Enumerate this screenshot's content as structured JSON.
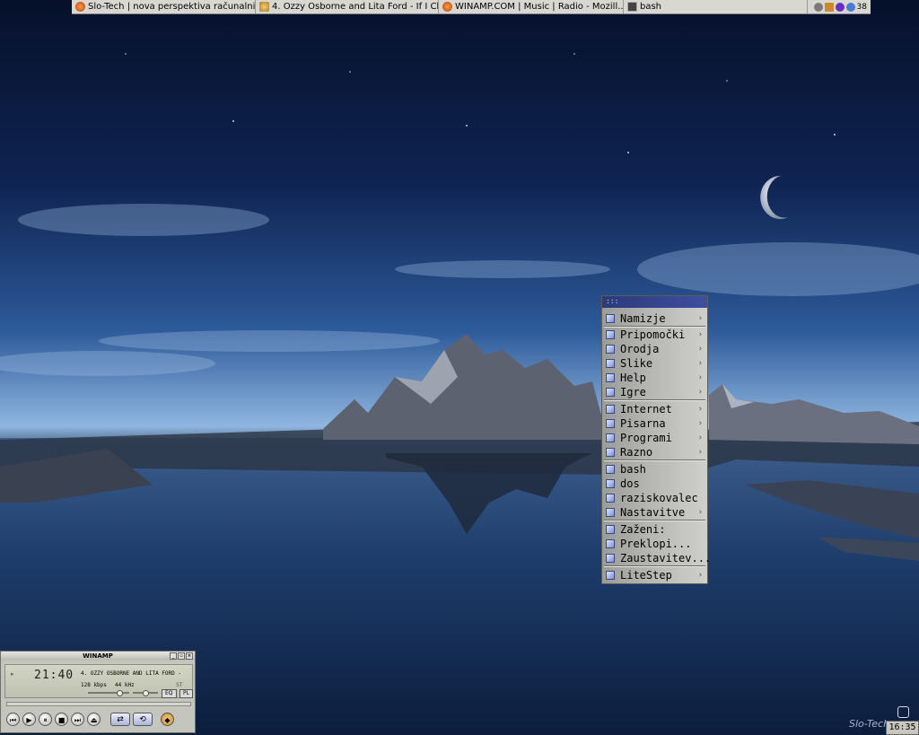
{
  "taskbar": {
    "tasks": [
      {
        "label": "Slo-Tech | nova perspektiva računalni...",
        "icon": "firefox-icon"
      },
      {
        "label": "4. Ozzy Osborne and Lita Ford - If I Cl...",
        "icon": "winamp-icon"
      },
      {
        "label": "WINAMP.COM | Music | Radio - Mozill...",
        "icon": "firefox-icon"
      },
      {
        "label": "bash",
        "icon": "terminal-icon"
      }
    ],
    "tray_text": "38"
  },
  "menu": {
    "title": ":::",
    "items": [
      {
        "label": "Namizje",
        "submenu": true
      },
      {
        "label": "Pripomočki",
        "submenu": true
      },
      {
        "label": "Orodja",
        "submenu": true
      },
      {
        "label": "Slike",
        "submenu": true
      },
      {
        "label": "Help",
        "submenu": true
      },
      {
        "label": "Igre",
        "submenu": true
      },
      {
        "label": "Internet",
        "submenu": true
      },
      {
        "label": "Pisarna",
        "submenu": true
      },
      {
        "label": "Programi",
        "submenu": true
      },
      {
        "label": "Razno",
        "submenu": true
      },
      {
        "label": "bash",
        "submenu": false
      },
      {
        "label": "dos",
        "submenu": false
      },
      {
        "label": "raziskovalec",
        "submenu": false
      },
      {
        "label": "Nastavitve",
        "submenu": true
      },
      {
        "label": "Zaženi:",
        "submenu": false
      },
      {
        "label": "Preklopi...",
        "submenu": false
      },
      {
        "label": "Zaustavitev...",
        "submenu": false
      },
      {
        "label": "LiteStep",
        "submenu": true
      }
    ],
    "arrow": "›"
  },
  "winamp": {
    "title": "WINAMP",
    "time": "21:40",
    "song": "4. OZZY OSBORNE AND LITA FORD -",
    "kbps": "128 kbps",
    "khz": "44 kHz",
    "stereo": "ST",
    "eq": "EQ",
    "pl": "PL",
    "volume": 0.8,
    "controls": {
      "prev": "⏮",
      "play": "▶",
      "pause": "⏸",
      "stop": "■",
      "next": "⏭",
      "eject": "⏏",
      "shuffle": "⇄",
      "repeat": "⟲",
      "about": "◆"
    }
  },
  "clock": "16:35",
  "watermark": "Slo-Tech"
}
